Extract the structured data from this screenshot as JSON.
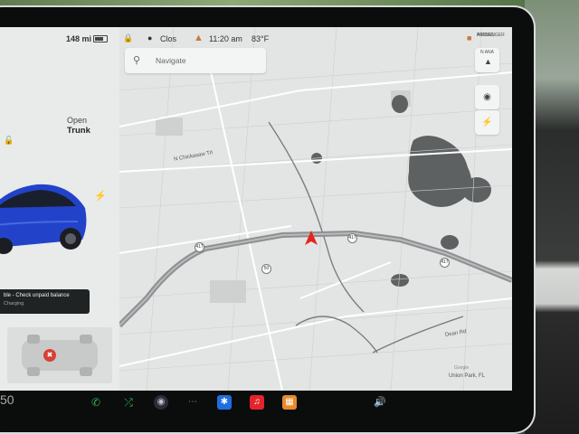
{
  "status": {
    "range": "148 mi",
    "user": "Clos",
    "time": "11:20 am",
    "temperature": "83°F",
    "airbag_line1": "PASSENGER",
    "airbag_line2": "AIRBAG"
  },
  "car_panel": {
    "trunk_open": "Open",
    "trunk_label": "Trunk",
    "toast_title": "ble - Check unpaid balance",
    "toast_sub": "Charging"
  },
  "map": {
    "search_placeholder": "Navigate",
    "compass_text": "N ANA",
    "road_labels": [
      "N Chickasaw Trl",
      "Dean Rd"
    ],
    "highway_shields": [
      "417",
      "417",
      "417",
      "50"
    ],
    "location": "Union Park, FL",
    "attribution": "Google"
  },
  "dock": {
    "speed_fragment": "50"
  },
  "colors": {
    "car_blue": "#2243c9",
    "nav_arrow": "#e2261f",
    "spotify": "#2fb24c",
    "bluetooth": "#1f6fe0",
    "music": "#e3242b",
    "toybox": "#e88a2a"
  }
}
